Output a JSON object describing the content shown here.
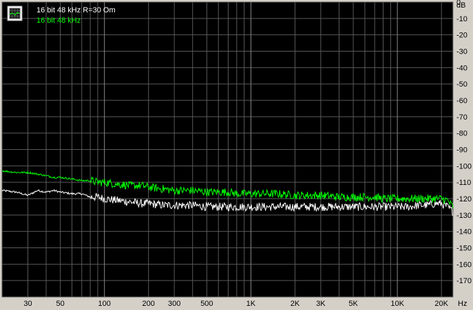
{
  "chart_data": {
    "type": "line",
    "title": "",
    "xlabel": "Hz",
    "ylabel": "dB",
    "x_scale": "log",
    "xlim": [
      20,
      24000
    ],
    "ylim": [
      -180,
      0
    ],
    "grid": true,
    "legend_placement": "top-left",
    "background": "#000000",
    "x_ticks": [
      {
        "value": 30,
        "label": "30"
      },
      {
        "value": 50,
        "label": "50"
      },
      {
        "value": 100,
        "label": "100"
      },
      {
        "value": 200,
        "label": "200"
      },
      {
        "value": 300,
        "label": "300"
      },
      {
        "value": 500,
        "label": "500"
      },
      {
        "value": 1000,
        "label": "1K"
      },
      {
        "value": 2000,
        "label": "2K"
      },
      {
        "value": 3000,
        "label": "3K"
      },
      {
        "value": 5000,
        "label": "5K"
      },
      {
        "value": 10000,
        "label": "10K"
      },
      {
        "value": 20000,
        "label": "20K"
      }
    ],
    "y_ticks": [
      {
        "value": 0,
        "label": "0"
      },
      {
        "value": -10,
        "label": "-10"
      },
      {
        "value": -20,
        "label": "-20"
      },
      {
        "value": -30,
        "label": "-30"
      },
      {
        "value": -40,
        "label": "-40"
      },
      {
        "value": -50,
        "label": "-50"
      },
      {
        "value": -60,
        "label": "-60"
      },
      {
        "value": -70,
        "label": "-70"
      },
      {
        "value": -80,
        "label": "-80"
      },
      {
        "value": -90,
        "label": "-90"
      },
      {
        "value": -100,
        "label": "-100"
      },
      {
        "value": -110,
        "label": "-110"
      },
      {
        "value": -120,
        "label": "-120"
      },
      {
        "value": -130,
        "label": "-130"
      },
      {
        "value": -140,
        "label": "-140"
      },
      {
        "value": -150,
        "label": "-150"
      },
      {
        "value": -160,
        "label": "-160"
      },
      {
        "value": -170,
        "label": "-170"
      }
    ],
    "series": [
      {
        "name": "16 bit 48 kHz R=30 Om",
        "color": "#ffffff",
        "x": [
          20,
          25,
          30,
          35,
          40,
          45,
          50,
          60,
          70,
          80,
          90,
          100,
          120,
          150,
          180,
          200,
          250,
          300,
          400,
          500,
          600,
          700,
          800,
          1000,
          1200,
          1500,
          2000,
          2500,
          3000,
          4000,
          5000,
          6000,
          7000,
          8000,
          10000,
          12000,
          14000,
          16000,
          18000,
          20000,
          22000,
          24000
        ],
        "y": [
          -115,
          -116,
          -118,
          -115,
          -116,
          -115,
          -116,
          -117,
          -117,
          -119,
          -119,
          -120,
          -121,
          -122,
          -123,
          -123,
          -124,
          -124,
          -124,
          -125,
          -125,
          -125,
          -125,
          -125,
          -125,
          -125,
          -125,
          -125,
          -125,
          -125,
          -125,
          -125,
          -125,
          -125,
          -125,
          -125,
          -124,
          -124,
          -123,
          -123,
          -125,
          -128
        ]
      },
      {
        "name": "16 bit 48 kHz",
        "color": "#00ff00",
        "x": [
          20,
          25,
          30,
          35,
          40,
          45,
          50,
          60,
          70,
          80,
          90,
          100,
          120,
          150,
          180,
          200,
          250,
          300,
          400,
          500,
          600,
          700,
          800,
          1000,
          1200,
          1500,
          2000,
          2500,
          3000,
          4000,
          5000,
          6000,
          7000,
          8000,
          10000,
          12000,
          14000,
          16000,
          18000,
          20000,
          22000,
          24000
        ],
        "y": [
          -103,
          -104,
          -104,
          -105,
          -106,
          -107,
          -107,
          -108,
          -109,
          -109,
          -110,
          -110,
          -111,
          -112,
          -112,
          -113,
          -114,
          -115,
          -115,
          -116,
          -116,
          -116,
          -117,
          -117,
          -117,
          -117,
          -118,
          -118,
          -118,
          -119,
          -119,
          -119,
          -119,
          -120,
          -120,
          -120,
          -120,
          -120,
          -120,
          -120,
          -121,
          -125
        ]
      }
    ],
    "noise_amplitude": 2.5
  }
}
